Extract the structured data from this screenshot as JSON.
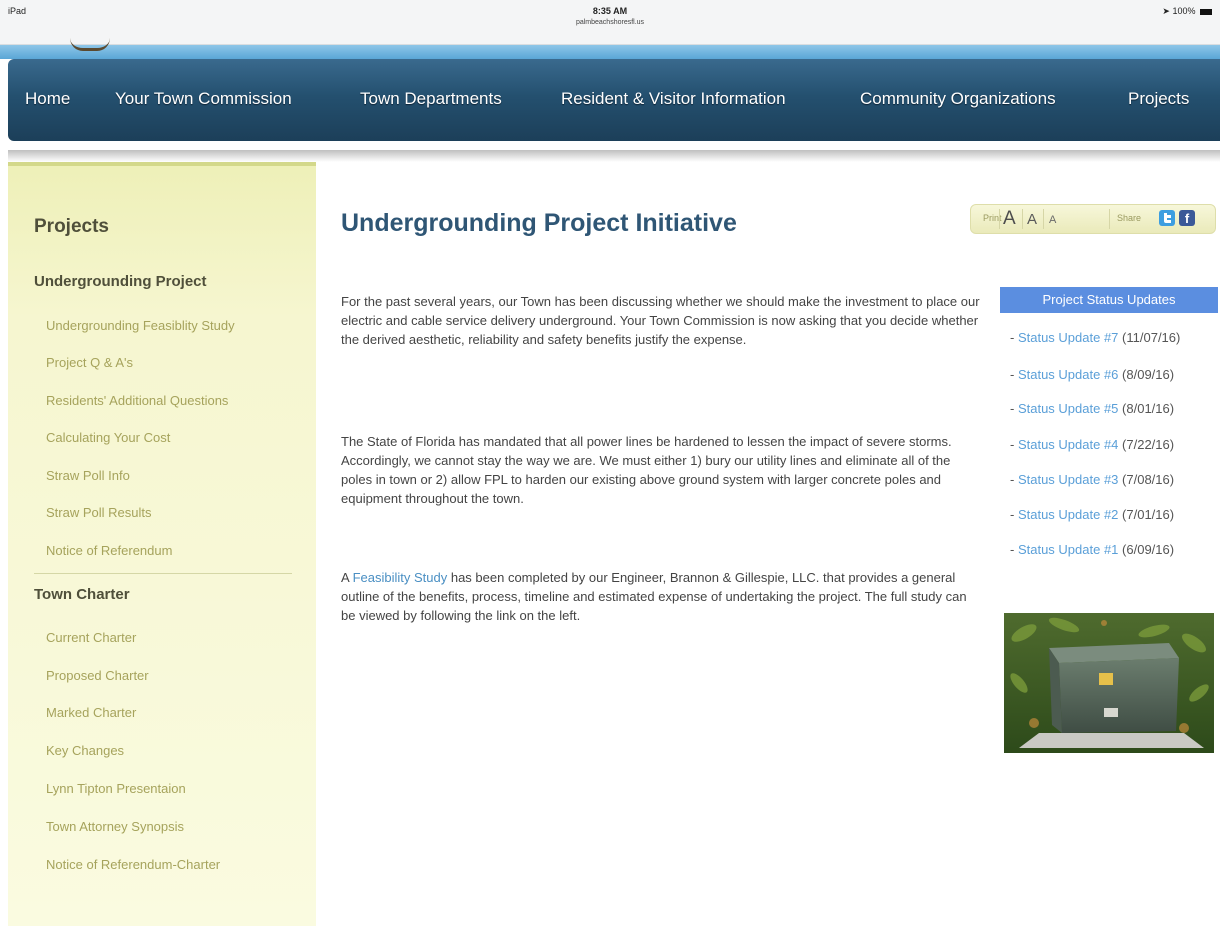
{
  "status_bar": {
    "device": "iPad",
    "time": "8:35 AM",
    "url": "palmbeachshoresfl.us",
    "battery": "100%"
  },
  "nav": {
    "items": [
      "Home",
      "Your Town Commission",
      "Town Departments",
      "Resident & Visitor Information",
      "Community Organizations",
      "Projects"
    ]
  },
  "sidebar": {
    "title": "Projects",
    "section1": {
      "title": "Undergrounding Project",
      "links": [
        "Undergrounding Feasiblity Study",
        "Project Q & A's",
        "Residents' Additional Questions",
        "Calculating Your Cost",
        "Straw Poll Info",
        "Straw Poll Results",
        "Notice of Referendum"
      ]
    },
    "section2": {
      "title": "Town Charter",
      "links": [
        "Current Charter",
        "Proposed Charter",
        "Marked Charter",
        "Key Changes",
        "Lynn Tipton Presentaion",
        "Town Attorney Synopsis",
        "Notice of Referendum-Charter"
      ]
    }
  },
  "main": {
    "title": "Undergrounding Project Initiative",
    "para1": "For the past several years, our Town has been discussing whether we should make the investment to place our electric and cable service delivery underground.  Your Town Commission is now asking that you decide whether the derived aesthetic, reliability and safety benefits justify the expense.",
    "para2": "The State of Florida has mandated that all power lines be hardened to lessen the impact of severe storms.  Accordingly, we cannot stay the way we are.  We must either 1) bury our utility lines and eliminate all of the poles in town or 2) allow FPL to harden our existing above ground system with larger concrete poles and equipment throughout the town.",
    "para3_prefix": "A ",
    "para3_link": "Feasibility Study",
    "para3_rest": " has been completed by our Engineer, Brannon & Gillespie, LLC. that provides a general outline of the benefits, process, timeline and estimated expense of undertaking the project.  The full study can be viewed by following the link on the left."
  },
  "tools": {
    "print": "Print",
    "font_large": "A",
    "font_medium": "A",
    "font_small": "A",
    "share": "Share",
    "facebook": "f"
  },
  "status_updates": {
    "header": "Project Status Updates",
    "items": [
      {
        "link": "Status Update #7",
        "date": "(11/07/16)"
      },
      {
        "link": "Status Update #6",
        "date": "(8/09/16)"
      },
      {
        "link": "Status Update #5",
        "date": "(8/01/16)"
      },
      {
        "link": "Status Update #4",
        "date": "(7/22/16)"
      },
      {
        "link": "Status Update #3",
        "date": "(7/08/16)"
      },
      {
        "link": "Status Update #2",
        "date": "(7/01/16)"
      },
      {
        "link": "Status Update #1",
        "date": "(6/09/16)"
      }
    ]
  },
  "colors": {
    "nav_blue": "#24506f",
    "title_blue": "#2f5675",
    "link_blue": "#5a9fd8",
    "sidebar_bg": "#f6f6d0",
    "sidebar_link": "#a6a35c",
    "status_header": "#5b8ee0"
  }
}
